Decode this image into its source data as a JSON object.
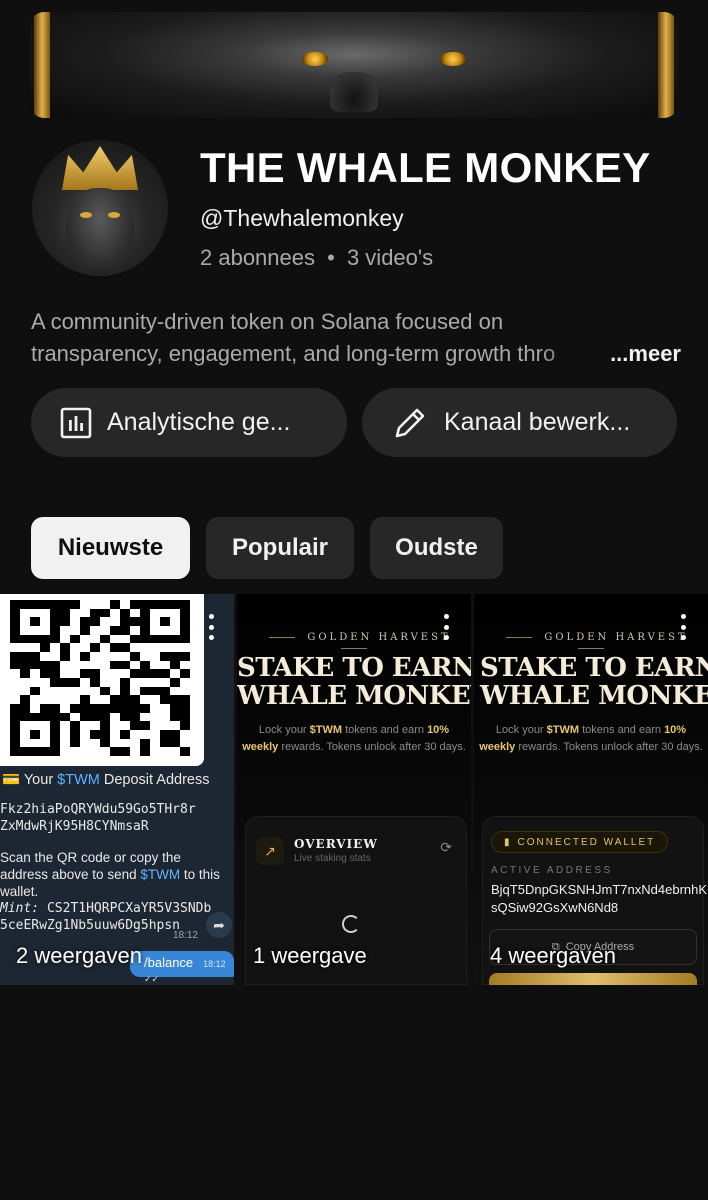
{
  "channel": {
    "name": "THE WHALE MONKEY",
    "handle": "@Thewhalemonkey",
    "subscribers": "2 abonnees",
    "separator": "•",
    "videos": "3 video's",
    "description_line1": "A community-driven token on Solana focused on",
    "description_line2": "transparency, engagement, and long-term growth thro",
    "more_label": "...meer"
  },
  "actions": {
    "analytics_label": "Analytische ge...",
    "edit_label": "Kanaal bewerk..."
  },
  "sort_chips": [
    {
      "label": "Nieuwste",
      "active": true
    },
    {
      "label": "Populair",
      "active": false
    },
    {
      "label": "Oudste",
      "active": false
    }
  ],
  "videos": [
    {
      "views": "2 weergaven",
      "deposit_title_pre": "Your ",
      "deposit_token": "$TWM",
      "deposit_title_post": " Deposit Address",
      "address_line1": "Fkz2hiaPoQRYWdu59Go5THr8r",
      "address_line2": "ZxMdwRjK95H8CYNmsaR",
      "instruction_pre": "Scan the QR code or copy the address above to send ",
      "instruction_token": "$TWM",
      "instruction_post": " to this wallet.",
      "mint_label": "Mint:",
      "mint_line1": "CS2T1HQRPCXaYR5V3SNDb",
      "mint_line2": "5ceERwZg1Nb5uuw6Dg5hpsn",
      "time": "18:12",
      "balance_label": "/balance",
      "balance_time": "18:12 ✓✓"
    },
    {
      "views": "1 weergave",
      "kicker": "GOLDEN HARVEST",
      "headline_1": "STAKE TO EARN",
      "headline_2": "WHALE MONKEY",
      "lock_pre": "Lock your ",
      "lock_token": "$TWM",
      "lock_mid": " tokens and earn ",
      "lock_pct": "10%",
      "lock_weekly": "weekly",
      "lock_post": " rewards. Tokens unlock after 30 days.",
      "overview_title": "OVERVIEW",
      "overview_sub": "Live staking stats"
    },
    {
      "views": "4 weergaven",
      "kicker": "GOLDEN HARVEST",
      "headline_1": "STAKE TO EARN",
      "headline_2": "WHALE MONKEY",
      "lock_pre": "Lock your ",
      "lock_token": "$TWM",
      "lock_mid": " tokens and earn ",
      "lock_pct": "10%",
      "lock_weekly": "weekly",
      "lock_post": " rewards. Tokens unlock after 30 days.",
      "wallet_badge": "CONNECTED WALLET",
      "active_address_label": "ACTIVE ADDRESS",
      "active_address": "BjqT5DnpGKSNHJmT7nxNd4ebrnhKsQSiw92GsXwN6Nd8",
      "copy_label": "Copy Address"
    }
  ],
  "icons": {
    "analytics": "bar-chart-icon",
    "edit": "pencil-icon",
    "menu": "more-vert-icon"
  },
  "colors": {
    "background": "#0f0f0f",
    "button": "#272727",
    "chip_active": "#f1f1f1",
    "secondary_text": "#aaaaaa",
    "gold": "#e2b24a",
    "telegram_blue": "#5fb2ff"
  }
}
